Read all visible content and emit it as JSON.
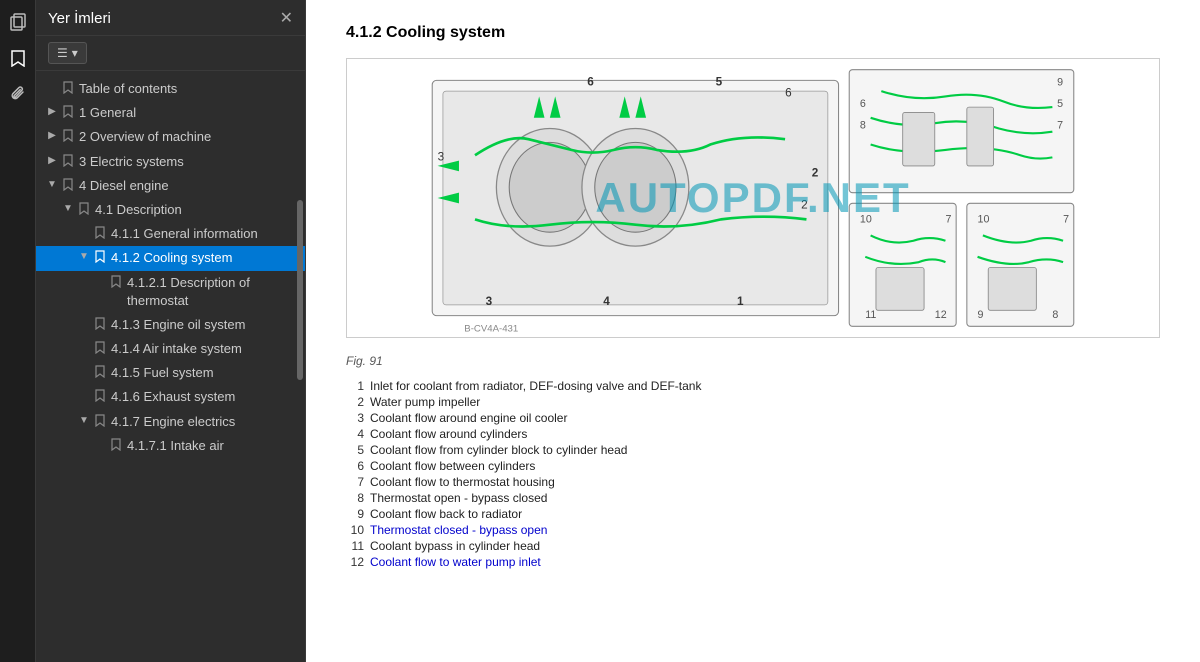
{
  "toolbar": {
    "icons": [
      {
        "name": "copy-icon",
        "symbol": "⧉"
      },
      {
        "name": "bookmark-icon",
        "symbol": "🔖"
      },
      {
        "name": "paperclip-icon",
        "symbol": "📎"
      }
    ]
  },
  "sidebar": {
    "title": "Yer İmleri",
    "close_label": "✕",
    "toolbar_btn": "☰ ▾",
    "items": [
      {
        "id": "toc",
        "label": "Table of contents",
        "indent": 0,
        "has_arrow": false,
        "arrow": "",
        "level": 0
      },
      {
        "id": "s1",
        "label": "1 General",
        "indent": 0,
        "has_arrow": true,
        "arrow": "▶",
        "level": 0
      },
      {
        "id": "s2",
        "label": "2 Overview of machine",
        "indent": 0,
        "has_arrow": true,
        "arrow": "▶",
        "level": 0
      },
      {
        "id": "s3",
        "label": "3 Electric systems",
        "indent": 0,
        "has_arrow": true,
        "arrow": "▶",
        "level": 0
      },
      {
        "id": "s4",
        "label": "4 Diesel engine",
        "indent": 0,
        "has_arrow": true,
        "arrow": "▼",
        "level": 0,
        "expanded": true
      },
      {
        "id": "s41",
        "label": "4.1 Description",
        "indent": 1,
        "has_arrow": true,
        "arrow": "▼",
        "level": 1,
        "expanded": true
      },
      {
        "id": "s411",
        "label": "4.1.1 General information",
        "indent": 2,
        "has_arrow": false,
        "arrow": "",
        "level": 2
      },
      {
        "id": "s412",
        "label": "4.1.2 Cooling system",
        "indent": 2,
        "has_arrow": true,
        "arrow": "▼",
        "level": 2,
        "active": true,
        "expanded": true
      },
      {
        "id": "s4121",
        "label": "4.1.2.1 Description of thermostat",
        "indent": 3,
        "has_arrow": false,
        "arrow": "",
        "level": 3
      },
      {
        "id": "s413",
        "label": "4.1.3 Engine oil system",
        "indent": 2,
        "has_arrow": false,
        "arrow": "",
        "level": 2
      },
      {
        "id": "s414",
        "label": "4.1.4 Air intake system",
        "indent": 2,
        "has_arrow": false,
        "arrow": "",
        "level": 2
      },
      {
        "id": "s415",
        "label": "4.1.5 Fuel system",
        "indent": 2,
        "has_arrow": false,
        "arrow": "",
        "level": 2
      },
      {
        "id": "s416",
        "label": "4.1.6 Exhaust system",
        "indent": 2,
        "has_arrow": false,
        "arrow": "",
        "level": 2
      },
      {
        "id": "s417",
        "label": "4.1.7 Engine electrics",
        "indent": 2,
        "has_arrow": true,
        "arrow": "▼",
        "level": 2,
        "expanded": true
      },
      {
        "id": "s4171",
        "label": "4.1.7.1 Intake air",
        "indent": 3,
        "has_arrow": false,
        "arrow": "",
        "level": 3
      }
    ]
  },
  "main": {
    "section_title": "4.1.2   Cooling system",
    "fig_caption": "Fig. 91",
    "watermark": "AUTOPDF.NET",
    "legend": [
      {
        "num": "1",
        "text": "Inlet for coolant from radiator, DEF-dosing valve and DEF-tank",
        "blue": false
      },
      {
        "num": "2",
        "text": "Water pump impeller",
        "blue": false
      },
      {
        "num": "3",
        "text": "Coolant flow around engine oil cooler",
        "blue": false
      },
      {
        "num": "4",
        "text": "Coolant flow around cylinders",
        "blue": false
      },
      {
        "num": "5",
        "text": "Coolant flow from cylinder block to cylinder head",
        "blue": false
      },
      {
        "num": "6",
        "text": "Coolant flow between cylinders",
        "blue": false
      },
      {
        "num": "7",
        "text": "Coolant flow to thermostat housing",
        "blue": false
      },
      {
        "num": "8",
        "text": "Thermostat open - bypass closed",
        "blue": false
      },
      {
        "num": "9",
        "text": "Coolant flow back to radiator",
        "blue": false
      },
      {
        "num": "10",
        "text": "Thermostat closed - bypass open",
        "blue": true
      },
      {
        "num": "11",
        "text": "Coolant bypass in cylinder head",
        "blue": false
      },
      {
        "num": "12",
        "text": "Coolant flow to water pump inlet",
        "blue": true
      }
    ]
  }
}
